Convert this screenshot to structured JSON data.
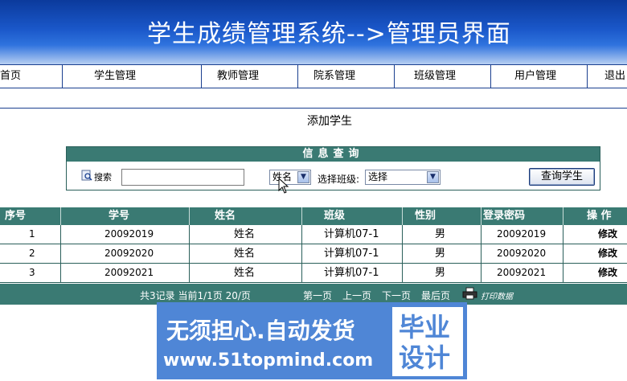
{
  "header": {
    "title": "学生成绩管理系统-->管理员界面"
  },
  "nav": {
    "items": [
      {
        "label": "首页"
      },
      {
        "label": "学生管理"
      },
      {
        "label": "教师管理"
      },
      {
        "label": "院系管理"
      },
      {
        "label": "班级管理"
      },
      {
        "label": "用户管理"
      },
      {
        "label": "退出"
      }
    ]
  },
  "section": {
    "title": "添加学生"
  },
  "search": {
    "header": "信息查询",
    "label": "搜索",
    "input_value": "",
    "field_select": "姓名",
    "class_label": "选择班级:",
    "class_select": "选择",
    "query_button": "查询学生"
  },
  "table": {
    "columns": [
      "序号",
      "学号",
      "姓名",
      "班级",
      "性别",
      "登录密码",
      "操 作"
    ],
    "rows": [
      {
        "index": "1",
        "id": "20092019",
        "name": "姓名",
        "class": "计算机07-1",
        "gender": "男",
        "password": "20092019",
        "action": "修改"
      },
      {
        "index": "2",
        "id": "20092020",
        "name": "姓名",
        "class": "计算机07-1",
        "gender": "男",
        "password": "20092020",
        "action": "修改"
      },
      {
        "index": "3",
        "id": "20092021",
        "name": "姓名",
        "class": "计算机07-1",
        "gender": "男",
        "password": "20092021",
        "action": "修改"
      }
    ]
  },
  "pagination": {
    "summary": "共3记录  当前1/1页  20/页",
    "first": "第一页",
    "prev": "上一页",
    "next": "下一页",
    "last": "最后页",
    "print": "打印数据"
  },
  "watermark": {
    "line1": "无须担心.自动发货",
    "line2": "www.51topmind.com",
    "box_line1": "毕业",
    "box_line2": "设计"
  }
}
